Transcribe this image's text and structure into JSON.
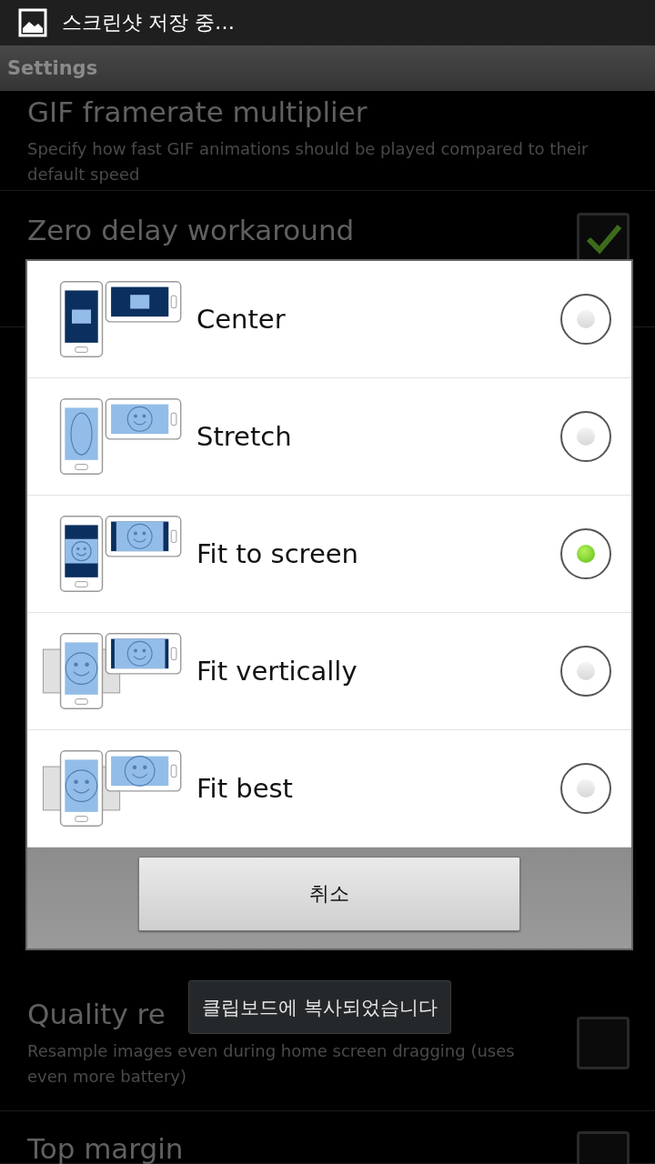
{
  "status_bar": {
    "notification": "스크린샷 저장 중…"
  },
  "action_bar": {
    "title": "Settings"
  },
  "settings_top": [
    {
      "title": "GIF framerate multiplier",
      "summary": "Specify how fast GIF animations should be played compared to their default speed"
    },
    {
      "title": "Zero delay workaround",
      "checked": true
    }
  ],
  "settings_bottom": [
    {
      "title": "Quality re",
      "summary": "Resample images even during home screen dragging (uses even more battery)",
      "checked": false
    },
    {
      "title": "Top margin",
      "checked": false
    }
  ],
  "dialog": {
    "options": [
      {
        "label": "Center",
        "kind": "center",
        "selected": false
      },
      {
        "label": "Stretch",
        "kind": "stretch",
        "selected": false
      },
      {
        "label": "Fit to screen",
        "kind": "fit_screen",
        "selected": true
      },
      {
        "label": "Fit vertically",
        "kind": "fit_vertical",
        "selected": false
      },
      {
        "label": "Fit best",
        "kind": "fit_best",
        "selected": false
      }
    ],
    "cancel_button": "취소"
  },
  "toast": "클립보드에 복사되었습니다"
}
